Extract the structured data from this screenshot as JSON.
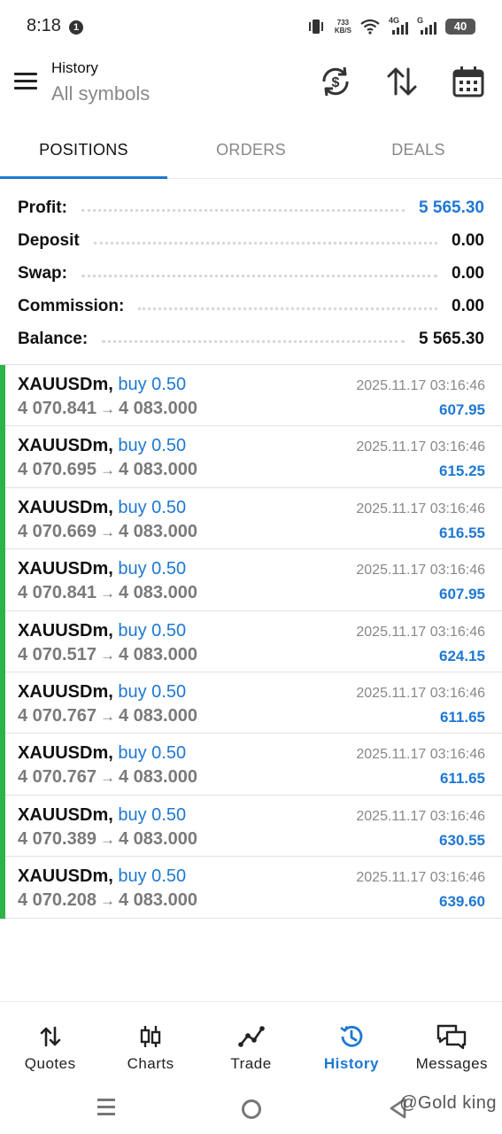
{
  "status_bar": {
    "time": "8:18",
    "notif_badge": "1",
    "net_speed_value": "733",
    "net_speed_unit": "KB/S",
    "signal_1": "4G",
    "signal_2": "G",
    "battery": "40"
  },
  "header": {
    "title": "History",
    "subtitle": "All symbols",
    "icons": [
      "currency-sync-icon",
      "sort-icon",
      "calendar-icon"
    ]
  },
  "tabs": [
    {
      "label": "POSITIONS",
      "active": true
    },
    {
      "label": "ORDERS",
      "active": false
    },
    {
      "label": "DEALS",
      "active": false
    }
  ],
  "summary": [
    {
      "label": "Profit:",
      "value": "5 565.30",
      "highlight": true
    },
    {
      "label": "Deposit",
      "value": "0.00",
      "highlight": false
    },
    {
      "label": "Swap:",
      "value": "0.00",
      "highlight": false
    },
    {
      "label": "Commission:",
      "value": "0.00",
      "highlight": false
    },
    {
      "label": "Balance:",
      "value": "5 565.30",
      "highlight": false
    }
  ],
  "positions": [
    {
      "symbol": "XAUUSDm,",
      "side": "buy 0.50",
      "open": "4 070.841",
      "arrow": "→",
      "close": "4 083.000",
      "time": "2025.11.17 03:16:46",
      "profit": "607.95"
    },
    {
      "symbol": "XAUUSDm,",
      "side": "buy 0.50",
      "open": "4 070.695",
      "arrow": "→",
      "close": "4 083.000",
      "time": "2025.11.17 03:16:46",
      "profit": "615.25"
    },
    {
      "symbol": "XAUUSDm,",
      "side": "buy 0.50",
      "open": "4 070.669",
      "arrow": "→",
      "close": "4 083.000",
      "time": "2025.11.17 03:16:46",
      "profit": "616.55"
    },
    {
      "symbol": "XAUUSDm,",
      "side": "buy 0.50",
      "open": "4 070.841",
      "arrow": "→",
      "close": "4 083.000",
      "time": "2025.11.17 03:16:46",
      "profit": "607.95"
    },
    {
      "symbol": "XAUUSDm,",
      "side": "buy 0.50",
      "open": "4 070.517",
      "arrow": "→",
      "close": "4 083.000",
      "time": "2025.11.17 03:16:46",
      "profit": "624.15"
    },
    {
      "symbol": "XAUUSDm,",
      "side": "buy 0.50",
      "open": "4 070.767",
      "arrow": "→",
      "close": "4 083.000",
      "time": "2025.11.17 03:16:46",
      "profit": "611.65"
    },
    {
      "symbol": "XAUUSDm,",
      "side": "buy 0.50",
      "open": "4 070.767",
      "arrow": "→",
      "close": "4 083.000",
      "time": "2025.11.17 03:16:46",
      "profit": "611.65"
    },
    {
      "symbol": "XAUUSDm,",
      "side": "buy 0.50",
      "open": "4 070.389",
      "arrow": "→",
      "close": "4 083.000",
      "time": "2025.11.17 03:16:46",
      "profit": "630.55"
    },
    {
      "symbol": "XAUUSDm,",
      "side": "buy 0.50",
      "open": "4 070.208",
      "arrow": "→",
      "close": "4 083.000",
      "time": "2025.11.17 03:16:46",
      "profit": "639.60"
    }
  ],
  "bottom_nav": [
    {
      "label": "Quotes",
      "icon": "quotes-icon",
      "active": false
    },
    {
      "label": "Charts",
      "icon": "charts-icon",
      "active": false
    },
    {
      "label": "Trade",
      "icon": "trade-icon",
      "active": false
    },
    {
      "label": "History",
      "icon": "history-icon",
      "active": true
    },
    {
      "label": "Messages",
      "icon": "messages-icon",
      "active": false
    }
  ],
  "watermark": "@Gold king",
  "colors": {
    "accent": "#1e78d2",
    "profit_bar": "#2db34a",
    "muted_text": "#888888"
  }
}
